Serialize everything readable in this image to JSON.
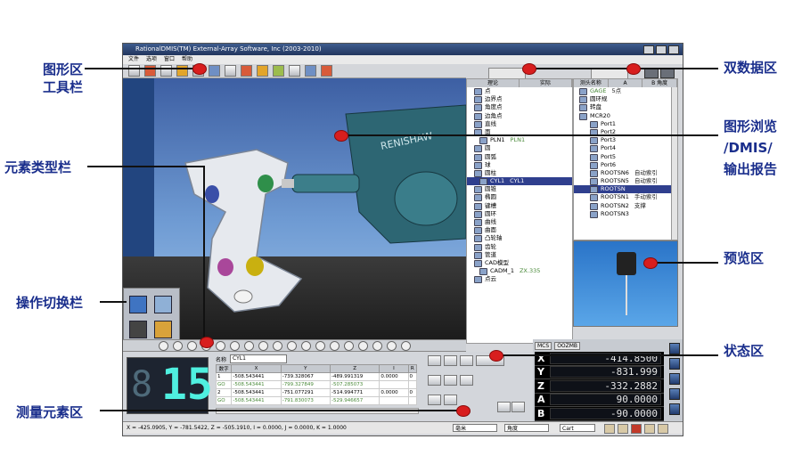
{
  "annotations": {
    "graphics_toolbar_line1": "图形区",
    "graphics_toolbar_line2": "工具栏",
    "element_type_bar": "元素类型栏",
    "operation_switch_bar": "操作切换栏",
    "measured_elements_area": "测量元素区",
    "dual_data_area": "双数据区",
    "graphic_browse_line1": "图形浏览",
    "graphic_browse_line2": "/DMIS/",
    "graphic_browse_line3": "输出报告",
    "preview_area": "预览区",
    "status_area": "状态区"
  },
  "window": {
    "title": "RationalDMIS(TM) External-Array Software, Inc (2003-2010)"
  },
  "menu": [
    "文件",
    "选项",
    "窗口",
    "帮助"
  ],
  "feature_list": {
    "columns": [
      "理论",
      "实际"
    ],
    "rows": [
      {
        "label": "点",
        "actual": "",
        "selected": false
      },
      {
        "label": "边界点",
        "actual": "",
        "selected": false
      },
      {
        "label": "角度点",
        "actual": "",
        "selected": false
      },
      {
        "label": "边角点",
        "actual": "",
        "selected": false
      },
      {
        "label": "直线",
        "actual": "",
        "selected": false
      },
      {
        "label": "面",
        "actual": "",
        "selected": false
      },
      {
        "label": "PLN1",
        "actual": "PLN1",
        "selected": false
      },
      {
        "label": "圆",
        "actual": "",
        "selected": false
      },
      {
        "label": "圆弧",
        "actual": "",
        "selected": false
      },
      {
        "label": "球",
        "actual": "",
        "selected": false
      },
      {
        "label": "圆柱",
        "actual": "",
        "selected": false
      },
      {
        "label": "CYL1",
        "actual": "CYL1",
        "selected": true
      },
      {
        "label": "圆锥",
        "actual": "",
        "selected": false
      },
      {
        "label": "椭圆",
        "actual": "",
        "selected": false
      },
      {
        "label": "键槽",
        "actual": "",
        "selected": false
      },
      {
        "label": "圆环",
        "actual": "",
        "selected": false
      },
      {
        "label": "曲线",
        "actual": "",
        "selected": false
      },
      {
        "label": "曲面",
        "actual": "",
        "selected": false
      },
      {
        "label": "凸轮轴",
        "actual": "",
        "selected": false
      },
      {
        "label": "齿轮",
        "actual": "",
        "selected": false
      },
      {
        "label": "管道",
        "actual": "",
        "selected": false
      },
      {
        "label": "CAD模型",
        "actual": "",
        "selected": false
      },
      {
        "label": "CADM_1",
        "actual": "ZX.335",
        "selected": false
      },
      {
        "label": "点云",
        "actual": "",
        "selected": false
      }
    ]
  },
  "probe_list": {
    "columns": [
      "测头名称",
      "A",
      "B 角度"
    ],
    "rows": [
      {
        "label": "GAGE",
        "extra": "5点",
        "green": true,
        "selected": false
      },
      {
        "label": "圆环规",
        "extra": "",
        "green": false,
        "selected": false
      },
      {
        "label": "转盘",
        "extra": "",
        "green": false,
        "selected": false
      },
      {
        "label": "MCR20",
        "extra": "",
        "green": false,
        "selected": false
      },
      {
        "label": "Port1",
        "extra": "",
        "green": false,
        "selected": false
      },
      {
        "label": "Port2",
        "extra": "",
        "green": false,
        "selected": false
      },
      {
        "label": "Port3",
        "extra": "",
        "green": false,
        "selected": false
      },
      {
        "label": "Port4",
        "extra": "",
        "green": false,
        "selected": false
      },
      {
        "label": "Port5",
        "extra": "",
        "green": false,
        "selected": false
      },
      {
        "label": "Port6",
        "extra": "",
        "green": false,
        "selected": false
      },
      {
        "label": "ROOTSN6",
        "extra": "自动索引",
        "green": false,
        "selected": false
      },
      {
        "label": "ROOTSN5",
        "extra": "自动索引",
        "green": false,
        "selected": false
      },
      {
        "label": "ROOTSN",
        "extra": "",
        "green": false,
        "selected": true
      },
      {
        "label": "ROOTSN1",
        "extra": "手动索引",
        "green": false,
        "selected": false
      },
      {
        "label": "ROOTSN2",
        "extra": "支撑",
        "green": false,
        "selected": false
      },
      {
        "label": "ROOTSN3",
        "extra": "",
        "green": false,
        "selected": false
      }
    ]
  },
  "measure": {
    "count_left": "8",
    "count": "15",
    "name_label": "名称",
    "name_value": "CYL1",
    "columns": [
      "数字",
      "X",
      "Y",
      "Z",
      "I",
      "R"
    ],
    "rows": [
      {
        "c": [
          "1",
          "-508.543441",
          "-739.328067",
          "-489.991319",
          "0.0000",
          "0"
        ],
        "green": false
      },
      {
        "c": [
          "GO",
          "-508.543441",
          "-799.327849",
          "-507.285073",
          "",
          ""
        ],
        "green": true
      },
      {
        "c": [
          "2",
          "-508.543441",
          "-751.077291",
          "-514.994771",
          "0.0000",
          "0"
        ],
        "green": false
      },
      {
        "c": [
          "GO",
          "-508.543441",
          "-791.830073",
          "-529.946657",
          "",
          ""
        ],
        "green": true
      }
    ]
  },
  "status": {
    "machine_tab": "MCS",
    "mode_tab": "OOZMB",
    "coords": [
      {
        "axis": "X",
        "value": "-414.8500"
      },
      {
        "axis": "Y",
        "value": "-831.999"
      },
      {
        "axis": "Z",
        "value": "-332.2882"
      },
      {
        "axis": "A",
        "value": "90.0000"
      },
      {
        "axis": "B",
        "value": "-90.0000"
      }
    ]
  },
  "statusbar": {
    "coords_text": "X = -425.0905, Y = -781.5422, Z = -505.1910, I = 0.0000, J = 0.0000, K = 1.0000",
    "unit": "毫米",
    "angle": "角度",
    "mode": "Cart"
  }
}
